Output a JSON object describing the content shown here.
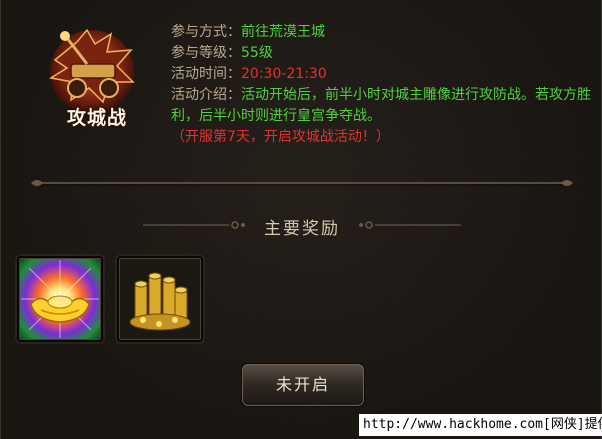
{
  "event": {
    "emblem_title": "攻城战",
    "rows": [
      {
        "label": "参与方式：",
        "value": "前往荒漠王城"
      },
      {
        "label": "参与等级：",
        "value": "55级"
      },
      {
        "label": "活动时间：",
        "value": "20:30-21:30"
      }
    ],
    "desc_label": "活动介绍：",
    "desc_text": "活动开始后，前半小时对城主雕像进行攻防战。若攻方胜利，后半小时则进行皇宫争夺战。",
    "desc_note": "（开服第7天，开启攻城战活动！）"
  },
  "rewards": {
    "title": "主要奖励",
    "items": [
      {
        "icon": "gold-ingot-icon"
      },
      {
        "icon": "gold-coin-pile-icon"
      }
    ]
  },
  "action": {
    "button_label": "未开启"
  },
  "watermark": "http://www.hackhome.com[网侠]提供",
  "colors": {
    "green": "#4fd23d",
    "red": "#e0332b",
    "label": "#b9a98e"
  }
}
